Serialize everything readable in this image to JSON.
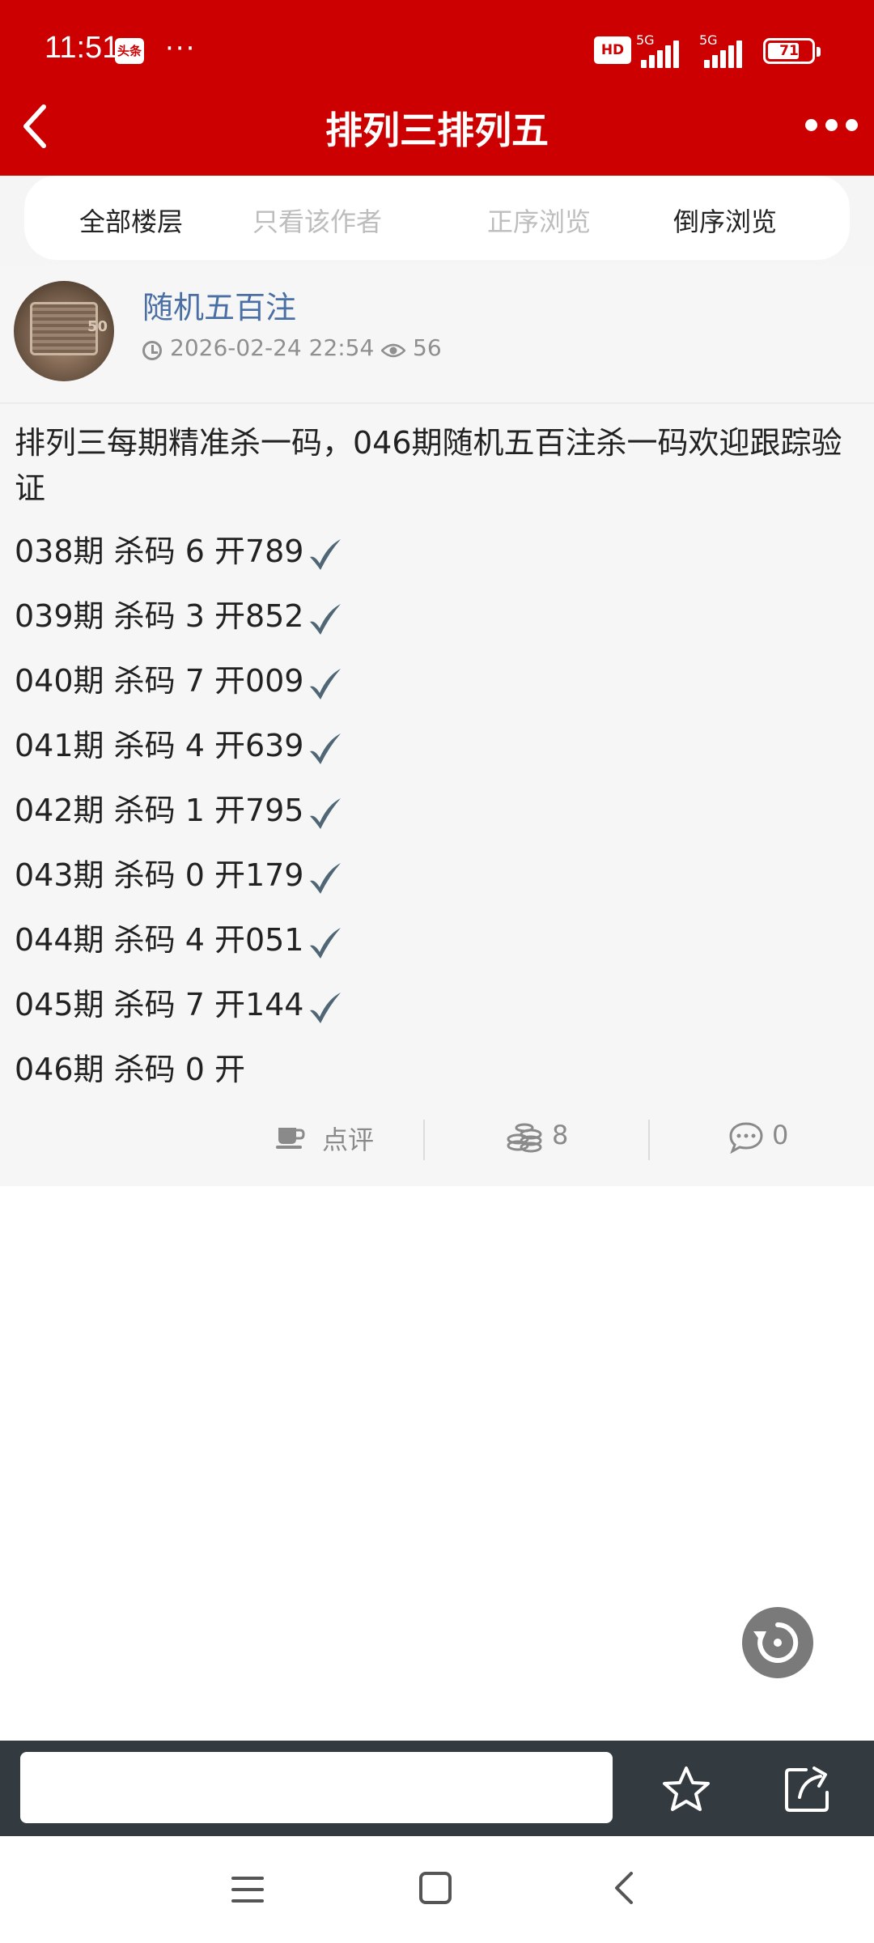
{
  "status_bar": {
    "time": "11:51",
    "app_badge": "头条",
    "more": "···",
    "hd": "HD",
    "network_1": "5G",
    "network_2": "5G",
    "battery": "71"
  },
  "header": {
    "title": "排列三排列五",
    "back_icon": "chevron-left-icon",
    "more_icon": "more-dots-icon",
    "bg_color": "#cc0000"
  },
  "tabs": [
    {
      "label": "全部楼层",
      "active": true
    },
    {
      "label": "只看该作者",
      "active": false
    },
    {
      "label": "正序浏览",
      "active": false
    },
    {
      "label": "倒序浏览",
      "active": true
    }
  ],
  "post": {
    "author": "随机五百注",
    "datetime": "2026-02-24 22:54",
    "views": "56",
    "intro": "排列三每期精准杀一码，046期随机五百注杀一码欢迎跟踪验证",
    "lines": [
      {
        "text": "038期 杀码 6 开789",
        "checked": true
      },
      {
        "text": "039期 杀码 3 开852",
        "checked": true
      },
      {
        "text": "040期 杀码 7 开009",
        "checked": true
      },
      {
        "text": "041期 杀码 4 开639",
        "checked": true
      },
      {
        "text": "042期 杀码 1 开795",
        "checked": true
      },
      {
        "text": "043期 杀码 0 开179",
        "checked": true
      },
      {
        "text": "044期 杀码 4 开051",
        "checked": true
      },
      {
        "text": "045期 杀码 7 开144",
        "checked": true
      },
      {
        "text": "046期 杀码 0 开",
        "checked": false
      }
    ],
    "actions": {
      "review_label": "点评",
      "coins": "8",
      "comments": "0"
    }
  },
  "bottom_bar": {
    "input_value": ""
  },
  "colors": {
    "accent": "#cc0000",
    "author_link": "#4a6fa5",
    "check": "#4f6675"
  }
}
